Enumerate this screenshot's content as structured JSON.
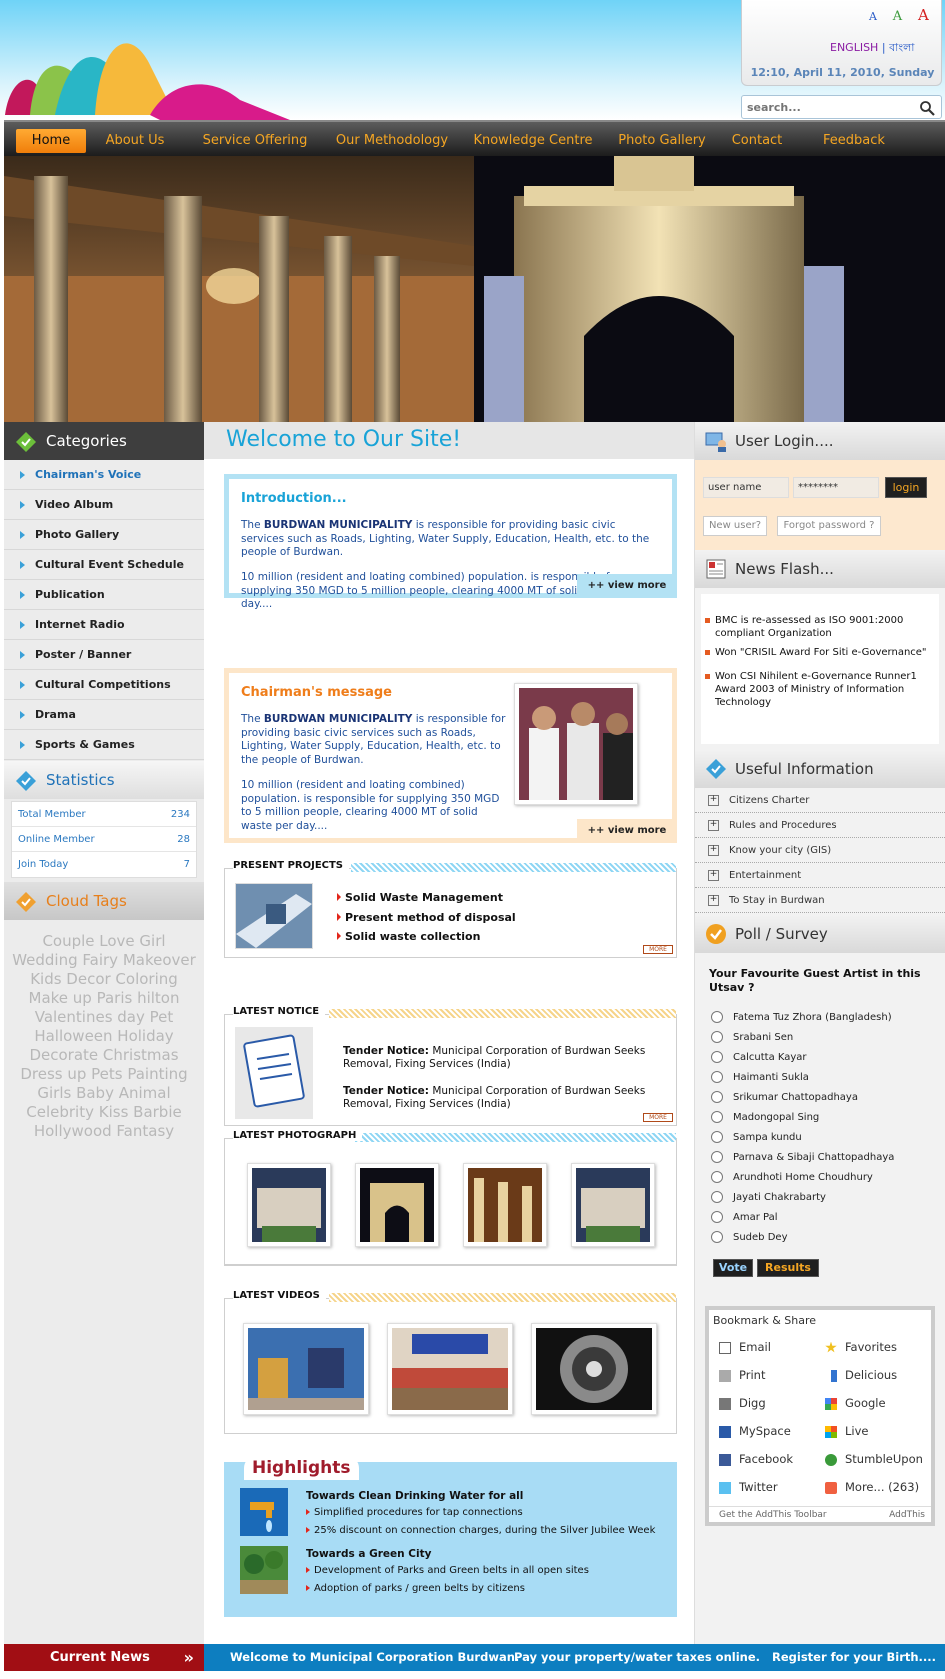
{
  "header": {
    "font_sizes": [
      "A",
      "A",
      "A"
    ],
    "lang_english": "ENGLISH",
    "lang_sep": "|",
    "lang_bangla": "বাংলা",
    "datetime": "12:10, April 11, 2010, Sunday",
    "search_placeholder": "search...",
    "icons": [
      "search-icon"
    ]
  },
  "nav": [
    "Home",
    "About Us",
    "Service Offering",
    "Our Methodology",
    "Knowledge Centre",
    "Photo Gallery",
    "Contact",
    "Feedback"
  ],
  "left": {
    "categories_title": "Categories",
    "categories": [
      "Chairman's Voice",
      "Video Album",
      "Photo Gallery",
      "Cultural Event Schedule",
      "Publication",
      "Internet Radio",
      "Poster / Banner",
      "Cultural Competitions",
      "Drama",
      "Sports & Games"
    ],
    "statistics_title": "Statistics",
    "stats": [
      {
        "label": "Total Member",
        "value": "234"
      },
      {
        "label": "Online Member",
        "value": "28"
      },
      {
        "label": "Join Today",
        "value": "7"
      }
    ],
    "tags_title": "Cloud Tags",
    "tags": "Couple Love Girl Wedding Fairy Makeover Kids Decor Coloring Make up Paris hilton Valentines day Pet Halloween Holiday Decorate Christmas Dress up Pets Painting Girls Baby Animal Celebrity Kiss Barbie Hollywood Fantasy"
  },
  "center": {
    "welcome": "Welcome to Our Site!",
    "intro_title": "Introduction...",
    "intro_p1_pre": "The ",
    "intro_p1_bold": "BURDWAN MUNICIPALITY",
    "intro_p1_post": " is responsible for providing basic civic services such as Roads, Lighting, Water Supply, Education, Health, etc. to the people of Burdwan.",
    "intro_p2": "10 million (resident and loating combined) population. is responsible for supplying 350 MGD to 5 million people, clearing 4000 MT of solid waste per day....",
    "view_more": "++ view more",
    "chair_title": "Chairman's message",
    "chair_p1_pre": "The ",
    "chair_p1_bold": "BURDWAN MUNICIPALITY",
    "chair_p1_post": " is responsible for providing basic civic services such as Roads, Lighting, Water Supply, Education, Health, etc. to the people of Burdwan.",
    "chair_p2": "10 million (resident and loating combined) population. is responsible for supplying 350 MGD to 5 million people, clearing 4000 MT of solid waste per day....",
    "projects_title": "PRESENT PROJECTS",
    "projects": [
      "Solid Waste Management",
      "Present method of disposal",
      "Solid waste collection"
    ],
    "more": "MORE",
    "notice_title": "LATEST NOTICE",
    "notices": [
      {
        "label": "Tender Notice:",
        "text": " Municipal Corporation of Burdwan Seeks Removal, Fixing Services (India)"
      },
      {
        "label": "Tender Notice:",
        "text": " Municipal Corporation of Burdwan Seeks Removal, Fixing Services (India)"
      }
    ],
    "photo_title": "LATEST PHOTOGRAPH",
    "videos_title": "LATEST VIDEOS",
    "highlights_title": "Highlights",
    "hl1_head": "Towards Clean Drinking Water for all",
    "hl1_items": [
      "Simplified procedures for tap connections",
      "25% discount on connection charges, during the Silver Jubilee Week"
    ],
    "hl2_head": "Towards a Green City",
    "hl2_items": [
      "Development of Parks and Green belts in all open sites",
      "Adoption of parks / green belts by citizens"
    ]
  },
  "right": {
    "login_title": "User Login....",
    "username_value": "user name",
    "password_value": "********",
    "login_btn": "login",
    "new_user": "New user?",
    "forgot": "Forgot password ?",
    "news_title": "News Flash...",
    "news": [
      "BMC is re-assessed as ISO 9001:2000 compliant Organization",
      "Won \"CRISIL Award For Siti e-Governance\"",
      "Won CSI Nihilent e-Governance Runner1 Award 2003 of Ministry of Information Technology"
    ],
    "useful_title": "Useful Information",
    "useful": [
      "Citizens Charter",
      "Rules and Procedures",
      "Know your city (GIS)",
      "Entertainment",
      "To Stay in Burdwan"
    ],
    "poll_title": "Poll / Survey",
    "poll_question": "Your Favourite Guest Artist in this Utsav ?",
    "poll_options": [
      "Fatema Tuz Zhora (Bangladesh)",
      "Srabani Sen",
      "Calcutta Kayar",
      "Haimanti Sukla",
      "Srikumar Chattopadhaya",
      "Madongopal Sing",
      "Sampa kundu",
      "Parnava & Sibaji Chattopadhaya",
      "Arundhoti Home Choudhury",
      "Jayati Chakrabarty",
      "Amar Pal",
      "Sudeb Dey"
    ],
    "vote_btn": "Vote",
    "results_btn": "Results",
    "bookmark_title": "Bookmark & Share",
    "bookmarks_left": [
      "Email",
      "Print",
      "Digg",
      "MySpace",
      "Facebook",
      "Twitter"
    ],
    "bookmarks_right": [
      "Favorites",
      "Delicious",
      "Google",
      "Live",
      "StumbleUpon",
      "More... (263)"
    ],
    "addthis_toolbar": "Get the AddThis Toolbar",
    "addthis": "AddThis"
  },
  "ticker": {
    "label": "Current News",
    "items": [
      "Welcome to Municipal Corporation Burdwan.",
      "Pay your property/water taxes online.",
      "Register for your Birth...."
    ]
  },
  "colors": {
    "accent_blue": "#19a3d7",
    "nav_orange": "#f5a623",
    "ticker_red": "#a10e14",
    "ticker_blue": "#0d7ec0"
  }
}
